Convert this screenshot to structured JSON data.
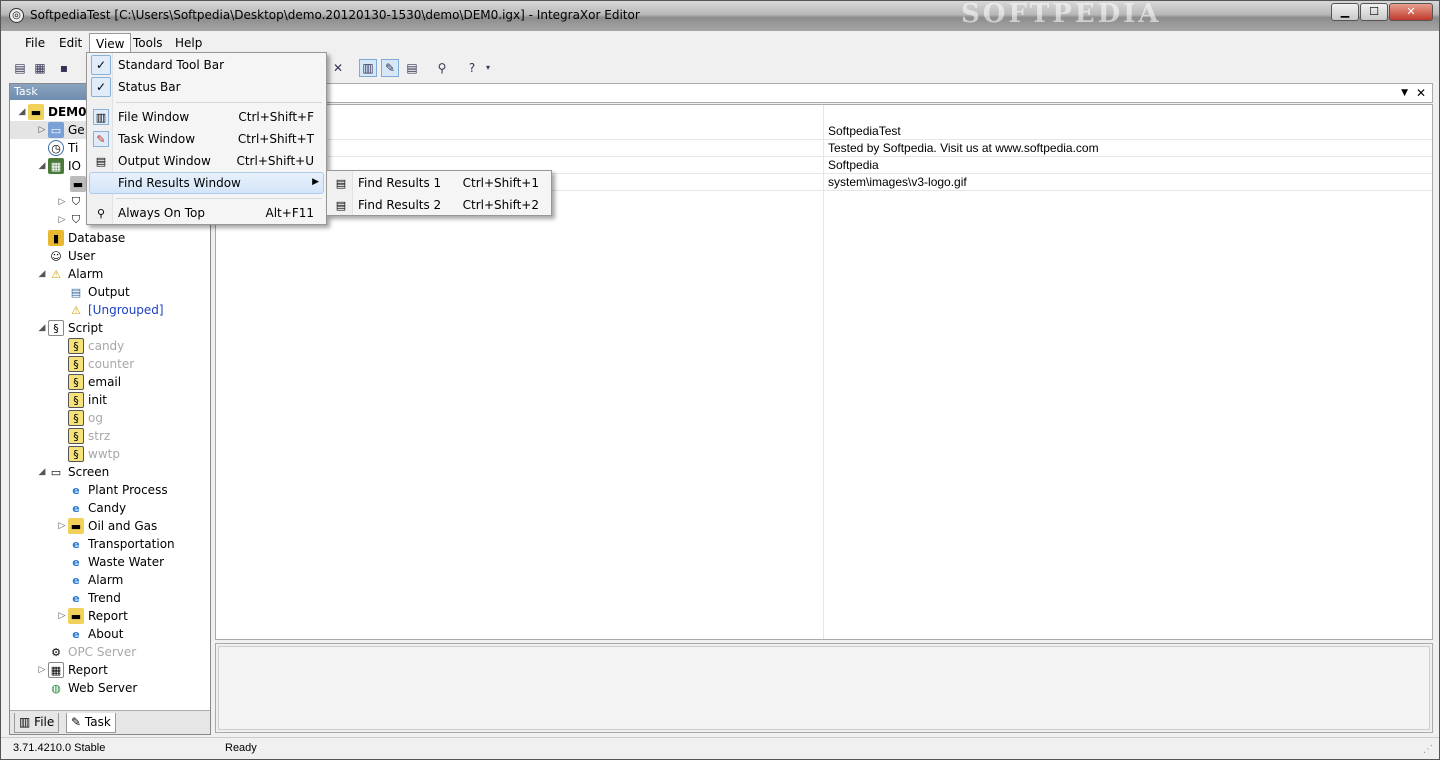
{
  "window": {
    "title": "SoftpediaTest [C:\\Users\\Softpedia\\Desktop\\demo.20120130-1530\\demo\\DEM0.igx] - IntegraXor Editor",
    "watermark": "SOFTPEDIA",
    "controls": {
      "minimize": "▁",
      "maximize": "☐",
      "close": "✕"
    }
  },
  "menubar": {
    "items": [
      "File",
      "Edit",
      "View",
      "Tools",
      "Help"
    ]
  },
  "task_panel": {
    "header": "Task",
    "tabs": [
      "File",
      "Task"
    ]
  },
  "tree": {
    "root": "DEM0",
    "general": "Ge",
    "timer": "Ti",
    "io": "IO",
    "database": "Database",
    "user": "User",
    "alarm": "Alarm",
    "alarm_output": "Output",
    "alarm_ungrouped": "[Ungrouped]",
    "script": "Script",
    "scripts": [
      "candy",
      "counter",
      "email",
      "init",
      "og",
      "strz",
      "wwtp"
    ],
    "screen": "Screen",
    "screens": [
      "Plant Process",
      "Candy",
      "Oil and Gas",
      "Transportation",
      "Waste Water",
      "Alarm",
      "Trend",
      "Report",
      "About"
    ],
    "opc_server": "OPC Server",
    "report": "Report",
    "web_server": "Web Server"
  },
  "properties": {
    "values": [
      "SoftpediaTest",
      "Tested by Softpedia. Visit us at www.softpedia.com",
      "Softpedia",
      "system\\images\\v3-logo.gif"
    ]
  },
  "view_menu": {
    "items": [
      {
        "label": "Standard Tool Bar",
        "shortcut": "",
        "checked": true
      },
      {
        "label": "Status Bar",
        "shortcut": "",
        "checked": true
      },
      {
        "label": "File Window",
        "shortcut": "Ctrl+Shift+F"
      },
      {
        "label": "Task Window",
        "shortcut": "Ctrl+Shift+T"
      },
      {
        "label": "Output Window",
        "shortcut": "Ctrl+Shift+U"
      },
      {
        "label": "Find Results Window",
        "shortcut": "",
        "submenu": true
      },
      {
        "label": "Always On Top",
        "shortcut": "Alt+F11"
      }
    ]
  },
  "find_results_submenu": {
    "items": [
      {
        "label": "Find Results 1",
        "shortcut": "Ctrl+Shift+1"
      },
      {
        "label": "Find Results 2",
        "shortcut": "Ctrl+Shift+2"
      }
    ]
  },
  "statusbar": {
    "version": "3.71.4210.0 Stable",
    "status": "Ready"
  },
  "colors": {
    "titlebar": "#a6a6a6",
    "task_header": "#6f8db0",
    "menu_highlight": "#d3e5fa",
    "link": "#1b3fc7"
  }
}
